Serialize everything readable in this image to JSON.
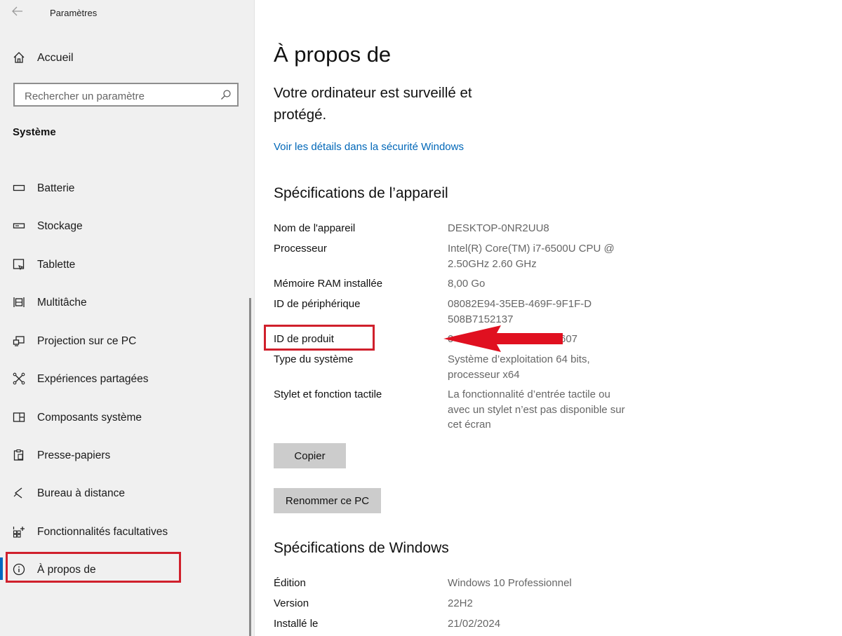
{
  "window": {
    "title": "Paramètres"
  },
  "sidebar": {
    "home_label": "Accueil",
    "search_placeholder": "Rechercher un paramètre",
    "section_title": "Système",
    "items": [
      {
        "label": "Batterie",
        "icon": "battery-icon"
      },
      {
        "label": "Stockage",
        "icon": "storage-icon"
      },
      {
        "label": "Tablette",
        "icon": "tablet-icon"
      },
      {
        "label": "Multitâche",
        "icon": "multitasking-icon"
      },
      {
        "label": "Projection sur ce PC",
        "icon": "projection-icon"
      },
      {
        "label": "Expériences partagées",
        "icon": "shared-experiences-icon"
      },
      {
        "label": "Composants système",
        "icon": "system-components-icon"
      },
      {
        "label": "Presse-papiers",
        "icon": "clipboard-icon"
      },
      {
        "label": "Bureau à distance",
        "icon": "remote-desktop-icon"
      },
      {
        "label": "Fonctionnalités facultatives",
        "icon": "optional-features-icon"
      },
      {
        "label": "À propos de",
        "icon": "info-icon",
        "active": true
      }
    ]
  },
  "main": {
    "title": "À propos de",
    "status": "Votre ordinateur est surveillé et protégé.",
    "security_link": "Voir les détails dans la sécurité Windows",
    "device_specs_title": "Spécifications de l’appareil",
    "device_specs": [
      {
        "label": "Nom de l'appareil",
        "value": "DESKTOP-0NR2UU8"
      },
      {
        "label": "Processeur",
        "value": "Intel(R) Core(TM) i7-6500U CPU @ 2.50GHz   2.60 GHz"
      },
      {
        "label": "Mémoire RAM installée",
        "value": "8,00 Go"
      },
      {
        "label": "ID de périphérique",
        "value": "08082E94-35EB-469F-9F1F-D508B7152137"
      },
      {
        "label": "ID de produit",
        "value": "0",
        "value_end": "607"
      },
      {
        "label": "Type du système",
        "value": "Système d’exploitation 64 bits, processeur x64"
      },
      {
        "label": "Stylet et fonction tactile",
        "value": "La fonctionnalité d’entrée tactile ou avec un stylet n’est pas disponible sur cet écran"
      }
    ],
    "copy_button": "Copier",
    "rename_button": "Renommer ce PC",
    "windows_specs_title": "Spécifications de Windows",
    "windows_specs": [
      {
        "label": "Édition",
        "value": "Windows 10 Professionnel"
      },
      {
        "label": "Version",
        "value": "22H2"
      },
      {
        "label": "Installé le",
        "value": "21/02/2024"
      }
    ]
  },
  "colors": {
    "accent": "#0067c0",
    "link": "#0067b8",
    "highlight": "#d0202c",
    "sidebar_bg": "#f0f0f0",
    "button_bg": "#cccccc"
  }
}
